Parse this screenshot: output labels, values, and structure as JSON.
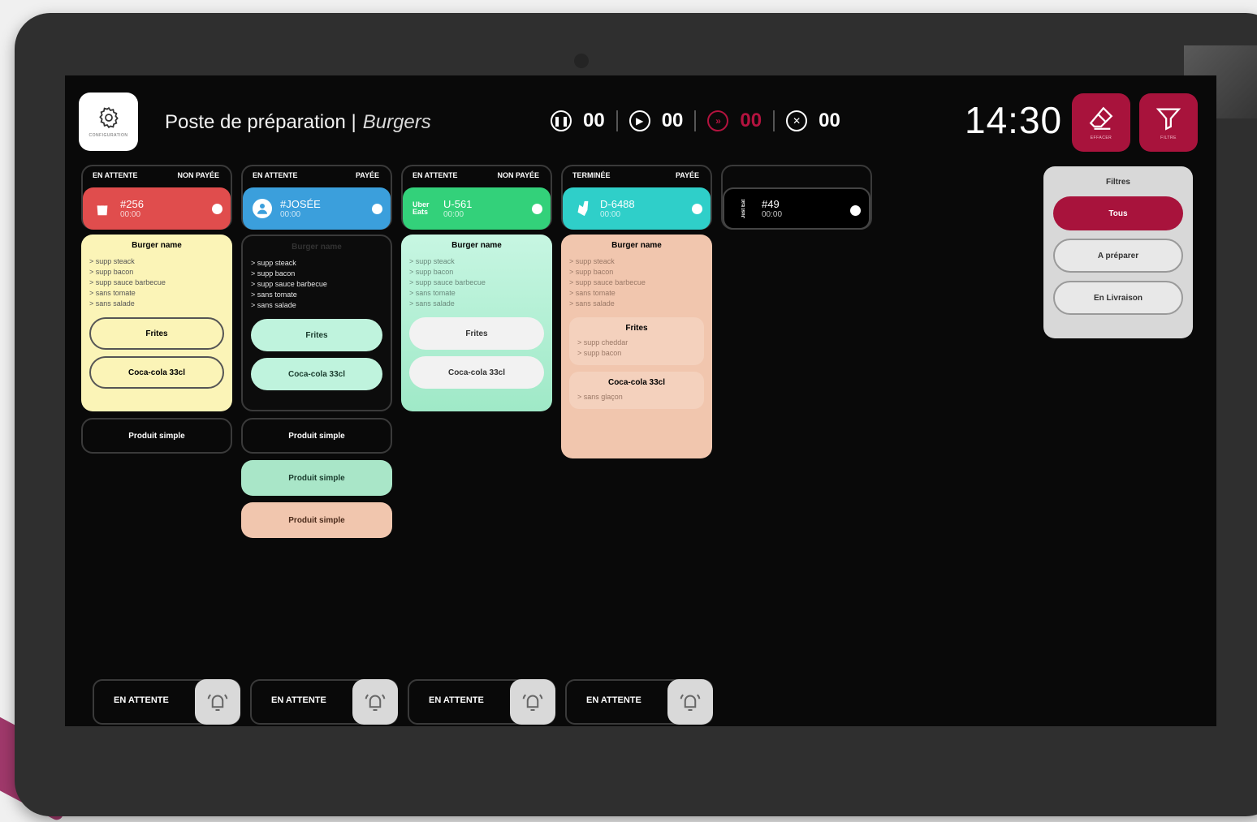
{
  "header": {
    "settings_caption": "CONFIGURATION",
    "title": "Poste de préparation |",
    "subtitle": "Burgers",
    "clock": "14:30",
    "erase_caption": "EFFACER",
    "filter_caption": "FILTRE"
  },
  "counters": [
    {
      "icon": "pause-icon",
      "value": "00"
    },
    {
      "icon": "play-icon",
      "value": "00"
    },
    {
      "icon": "fast-forward-icon",
      "value": "00"
    },
    {
      "icon": "cancel-icon",
      "value": "00"
    }
  ],
  "colors": {
    "accent": "#a8133c",
    "red": "#e04d4d",
    "blue": "#3b9fdc",
    "green": "#33d17a",
    "cyan": "#2fcfc9",
    "yellow_card": "#fbf4b7",
    "mint_card": "#bff3dd",
    "peach_card": "#f1c6ae"
  },
  "orders": [
    {
      "status": "EN ATTENTE",
      "payment": "NON PAYÉE",
      "number": "#256",
      "time": "00:00",
      "source_icon": "bag-icon",
      "card": {
        "title": "Burger name",
        "options": [
          "supp steack",
          "supp bacon",
          "supp sauce barbecue",
          "sans tomate",
          "sans salade"
        ],
        "subitems": [
          "Frites",
          "Coca-cola 33cl"
        ]
      },
      "simple_products": [
        "Produit simple"
      ]
    },
    {
      "status": "EN ATTENTE",
      "payment": "PAYÉE",
      "number": "#JOSÉE",
      "time": "00:00",
      "source_icon": "user-icon",
      "card": {
        "title": "Burger name",
        "options": [
          "supp steack",
          "supp bacon",
          "supp sauce barbecue",
          "sans tomate",
          "sans salade"
        ],
        "subitems": [
          "Frites",
          "Coca-cola 33cl"
        ]
      },
      "simple_products": [
        "Produit simple",
        "Produit simple",
        "Produit simple"
      ]
    },
    {
      "status": "EN ATTENTE",
      "payment": "NON PAYÉE",
      "number": "U-561",
      "time": "00:00",
      "source_icon": "uber-eats-icon",
      "source_text": "Uber Eats",
      "card": {
        "title": "Burger name",
        "options": [
          "supp steack",
          "supp bacon",
          "supp sauce barbecue",
          "sans tomate",
          "sans salade"
        ],
        "subitems": [
          "Frites",
          "Coca-cola 33cl"
        ]
      }
    },
    {
      "status": "TERMINÉE",
      "payment": "PAYÉE",
      "number": "D-6488",
      "time": "00:00",
      "source_icon": "deliveroo-icon",
      "card": {
        "title": "Burger name",
        "options": [
          "supp steack",
          "supp bacon",
          "supp sauce barbecue",
          "sans tomate",
          "sans salade"
        ],
        "blocks": [
          {
            "title": "Frites",
            "options": [
              "supp cheddar",
              "supp bacon"
            ]
          },
          {
            "title": "Coca-cola 33cl",
            "options": [
              "sans glaçon"
            ]
          }
        ]
      }
    },
    {
      "status": "",
      "payment": "",
      "number": "#49",
      "time": "00:00",
      "source_icon": "takeaway-icon",
      "source_text": "Just Eat"
    }
  ],
  "filters": {
    "title": "Filtres",
    "options": [
      "Tous",
      "A préparer",
      "En Livraison"
    ],
    "selected": "Tous"
  },
  "status_bars": [
    {
      "label": "EN ATTENTE"
    },
    {
      "label": "EN ATTENTE"
    },
    {
      "label": "EN ATTENTE"
    },
    {
      "label": "EN ATTENTE"
    }
  ]
}
